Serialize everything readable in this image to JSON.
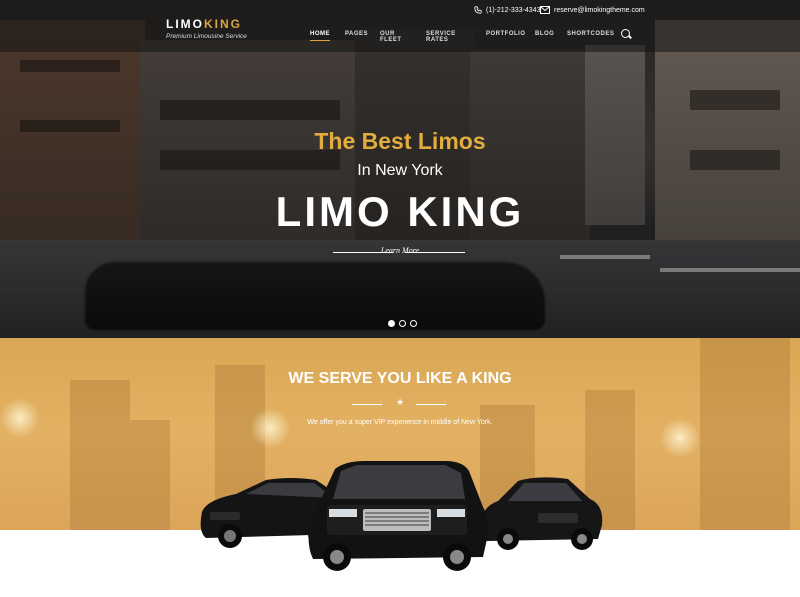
{
  "header": {
    "logo_main": "LIMO",
    "logo_accent": "KING",
    "tagline": "Premium Limousine Service",
    "phone": "(1)-212-333-4343",
    "email": "reserve@limokingtheme.com",
    "nav": [
      "HOME",
      "PAGES",
      "OUR FLEET",
      "SERVICE RATES",
      "PORTFOLIO",
      "BLOG",
      "SHORTCODES"
    ],
    "active_nav": "HOME"
  },
  "hero": {
    "line1": "The Best Limos",
    "line2": "In New York",
    "line3": "LIMO KING",
    "cta": "Learn More",
    "slider_dots": 3,
    "active_dot": 1
  },
  "section": {
    "title": "WE SERVE YOU LIKE A KING",
    "subtitle": "We offer you a super VIP experience in middle of New York."
  },
  "colors": {
    "accent": "#d9a63f",
    "gold_bg": "#e1ae60"
  }
}
